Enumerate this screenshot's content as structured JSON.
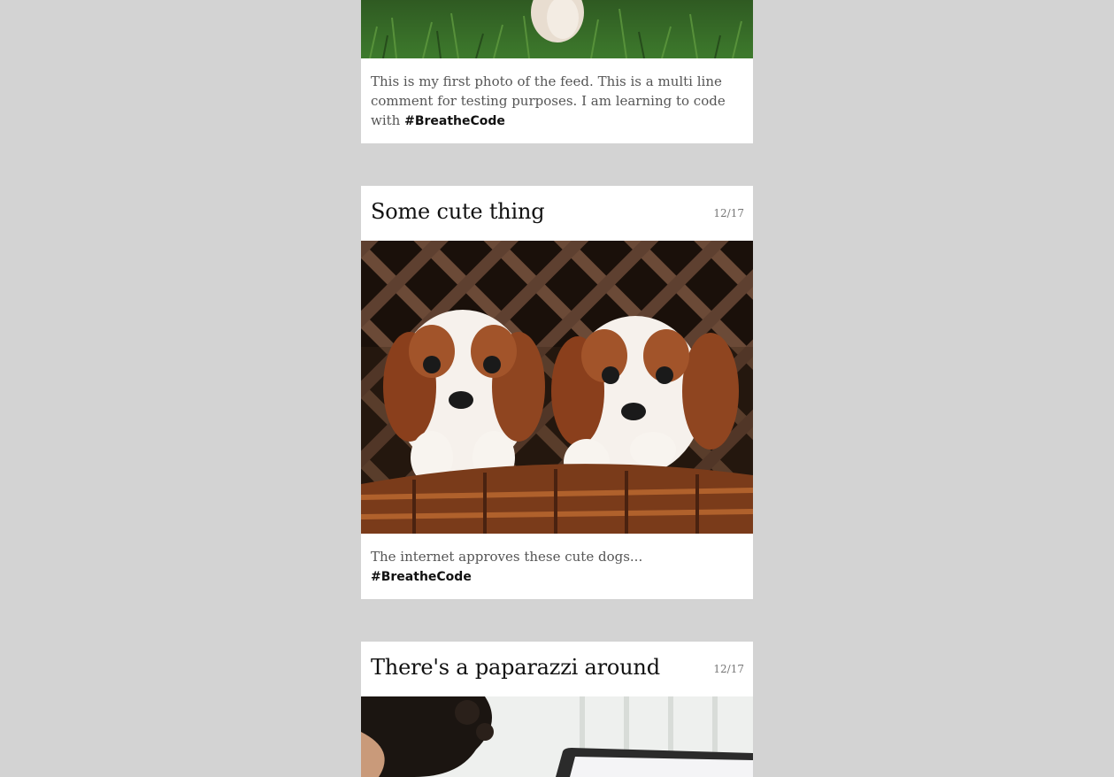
{
  "feed": {
    "posts": [
      {
        "title": "",
        "date": "",
        "caption": "This is my first photo of the feed. This is a multi line comment for testing purposes. I am learning to code with",
        "hashtag": "#BreatheCode",
        "photo_icon": "photo-grass-pet"
      },
      {
        "title": "Some cute thing",
        "date": "12/17",
        "caption": "The internet approves these cute dogs...",
        "hashtag": "#BreatheCode",
        "photo_icon": "photo-puppies-in-basket"
      },
      {
        "title": "There's a paparazzi around",
        "date": "12/17",
        "caption": "",
        "hashtag": "",
        "photo_icon": "photo-person-with-laptop"
      }
    ]
  },
  "colors": {
    "page_background": "#d3d3d3",
    "card_background": "#ffffff",
    "title_text": "#111111",
    "caption_text": "#555555",
    "date_text": "#777777"
  }
}
